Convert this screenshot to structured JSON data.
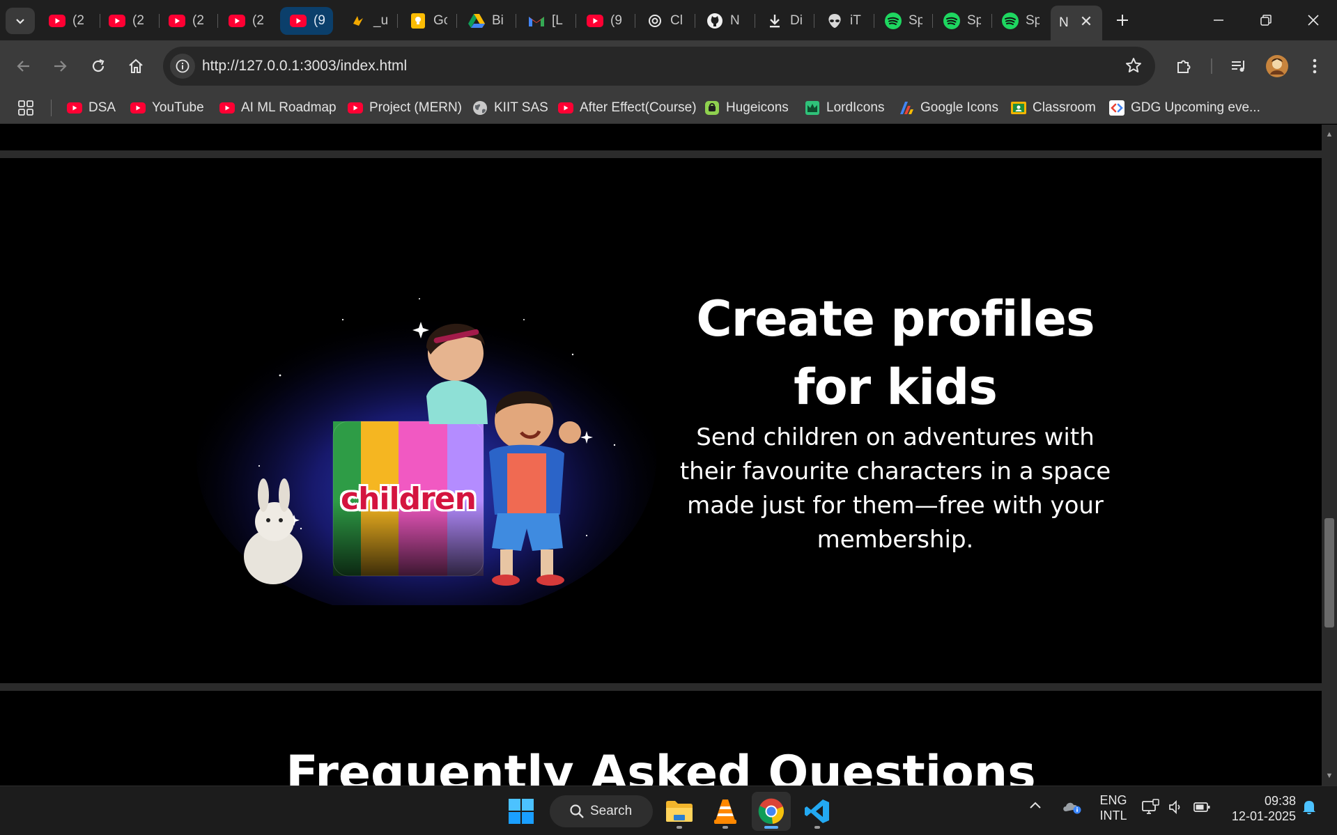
{
  "browser": {
    "tabs": [
      {
        "title": "(2",
        "icon": "youtube-icon"
      },
      {
        "title": "(2",
        "icon": "youtube-icon"
      },
      {
        "title": "(2",
        "icon": "youtube-icon"
      },
      {
        "title": "(2",
        "icon": "youtube-icon"
      },
      {
        "title": "(9",
        "icon": "youtube-icon"
      },
      {
        "title": "_u",
        "icon": "sound-icon"
      },
      {
        "title": "Gc",
        "icon": "keep-icon"
      },
      {
        "title": "Bi",
        "icon": "drive-icon"
      },
      {
        "title": "[L",
        "icon": "gmail-icon"
      },
      {
        "title": "(9",
        "icon": "youtube-icon"
      },
      {
        "title": "Cl",
        "icon": "openai-icon"
      },
      {
        "title": "N",
        "icon": "github-icon"
      },
      {
        "title": "Di",
        "icon": "download-icon"
      },
      {
        "title": "iT",
        "icon": "alien-icon"
      },
      {
        "title": "Sp",
        "icon": "spotify-icon"
      },
      {
        "title": "Sp",
        "icon": "spotify-icon"
      },
      {
        "title": "Sp",
        "icon": "spotify-icon"
      },
      {
        "title": "N",
        "icon": "close-icon"
      }
    ],
    "url": "http://127.0.0.1:3003/index.html",
    "bookmarks": [
      {
        "label": "DSA",
        "icon": "youtube-icon"
      },
      {
        "label": "YouTube",
        "icon": "youtube-icon"
      },
      {
        "label": "AI ML Roadmap",
        "icon": "youtube-icon"
      },
      {
        "label": "Project (MERN)",
        "icon": "youtube-icon"
      },
      {
        "label": "KIIT SAS",
        "icon": "globe-icon"
      },
      {
        "label": "After Effect(Course)",
        "icon": "youtube-icon"
      },
      {
        "label": "Hugeicons",
        "icon": "hugeicons-icon"
      },
      {
        "label": "LordIcons",
        "icon": "lordicons-icon"
      },
      {
        "label": "Google Icons",
        "icon": "google-icons-icon"
      },
      {
        "label": "Classroom",
        "icon": "classroom-icon"
      },
      {
        "label": "GDG Upcoming eve...",
        "icon": "gdg-icon"
      }
    ]
  },
  "page": {
    "kids_title_line1": "Create profiles",
    "kids_title_line2": "for kids",
    "kids_description": "Send children on adventures with their favourite characters in a space made just for them—free with your membership.",
    "kids_badge": "children",
    "faq_title": "Frequently Asked Questions"
  },
  "taskbar": {
    "search_label": "Search",
    "language_line1": "ENG",
    "language_line2": "INTL",
    "time": "09:38",
    "date": "12-01-2025",
    "apps": [
      "windows-start-icon",
      "file-explorer-icon",
      "vlc-icon",
      "chrome-icon",
      "vscode-icon"
    ]
  },
  "colors": {
    "youtube_red": "#ff0033",
    "spotify_green": "#1ed760",
    "accent_blue": "#5bb0ff"
  }
}
